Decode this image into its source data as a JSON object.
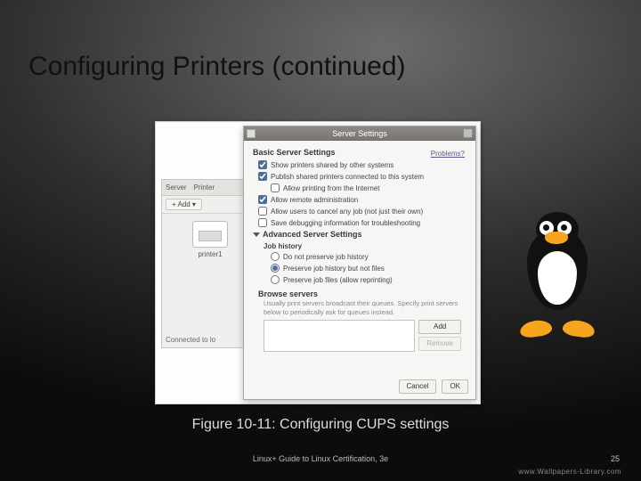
{
  "slide": {
    "title": "Configuring Printers (continued)",
    "caption": "Figure 10-11: Configuring CUPS settings",
    "footer_left": "Linux+ Guide to Linux Certification, 3e",
    "page_number": "25",
    "watermark": "www.Wallpapers-Library.com"
  },
  "bgwin": {
    "tab_server": "Server",
    "tab_printer": "Printer",
    "add_label": "+ Add",
    "add_caret": "▾",
    "printer_label": "printer1",
    "status": "Connected to lo"
  },
  "dialog": {
    "title": "Server Settings",
    "problems_link": "Problems?",
    "section_basic": "Basic Server Settings",
    "opts": {
      "show_shared": "Show printers shared by other systems",
      "publish_shared": "Publish shared printers connected to this system",
      "allow_internet": "Allow printing from the Internet",
      "allow_remote_admin": "Allow remote administration",
      "allow_cancel_any": "Allow users to cancel any job (not just their own)",
      "save_debug": "Save debugging information for troubleshooting"
    },
    "section_advanced": "Advanced Server Settings",
    "job_history_head": "Job history",
    "job_history": {
      "none": "Do not preserve job history",
      "history_only": "Preserve job history but not files",
      "files": "Preserve job files (allow reprinting)"
    },
    "browse_head": "Browse servers",
    "browse_note": "Usually print servers broadcast their queues. Specify print servers below to periodically ask for queues instead.",
    "buttons": {
      "add": "Add",
      "remove": "Remove",
      "cancel": "Cancel",
      "ok": "OK"
    }
  }
}
